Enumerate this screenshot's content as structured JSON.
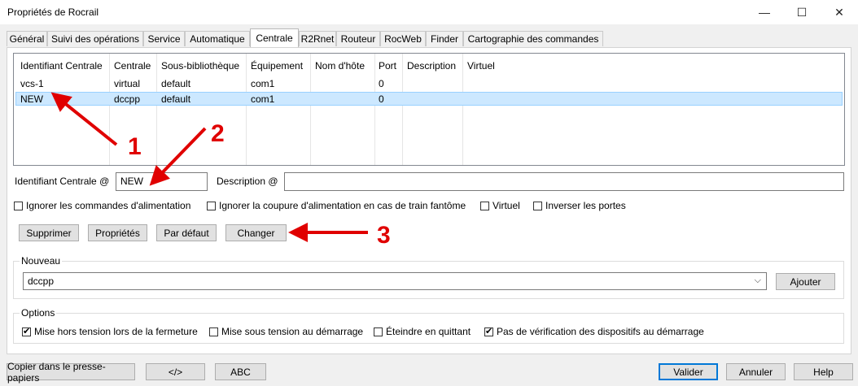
{
  "window": {
    "title": "Propriétés de Rocrail",
    "minimize_icon": "—",
    "maximize_icon": "☐",
    "close_icon": "✕"
  },
  "tabs": [
    {
      "label": "Général"
    },
    {
      "label": "Suivi des opérations"
    },
    {
      "label": "Service"
    },
    {
      "label": "Automatique"
    },
    {
      "label": "Centrale"
    },
    {
      "label": "R2Rnet"
    },
    {
      "label": "Routeur"
    },
    {
      "label": "RocWeb"
    },
    {
      "label": "Finder"
    },
    {
      "label": "Cartographie des commandes"
    }
  ],
  "table": {
    "headers": [
      "Identifiant Centrale",
      "Centrale",
      "Sous-bibliothèque",
      "Équipement",
      "Nom d'hôte",
      "Port",
      "Description",
      "Virtuel"
    ],
    "rows": [
      [
        "vcs-1",
        "virtual",
        "default",
        "com1",
        "",
        "0",
        "",
        ""
      ],
      [
        "NEW",
        "dccpp",
        "default",
        "com1",
        "",
        "0",
        "",
        ""
      ]
    ],
    "selected_row": 1
  },
  "form": {
    "id_label": "Identifiant Centrale @",
    "id_value": "NEW",
    "desc_label": "Description @",
    "desc_value": ""
  },
  "checkboxes": [
    {
      "label": "Ignorer les commandes d'alimentation",
      "checked": false
    },
    {
      "label": "Ignorer la coupure d'alimentation en cas de train fantôme",
      "checked": false
    },
    {
      "label": "Virtuel",
      "checked": false
    },
    {
      "label": "Inverser les portes",
      "checked": false
    }
  ],
  "actions": {
    "delete": "Supprimer",
    "props": "Propriétés",
    "default": "Par défaut",
    "change": "Changer"
  },
  "nouveau": {
    "title": "Nouveau",
    "selected": "dccpp",
    "add": "Ajouter"
  },
  "options": {
    "title": "Options",
    "items": [
      {
        "label": "Mise hors tension lors de la fermeture",
        "checked": true
      },
      {
        "label": "Mise sous tension au démarrage",
        "checked": false
      },
      {
        "label": "Éteindre en quittant",
        "checked": false
      },
      {
        "label": "Pas de vérification des dispositifs au démarrage",
        "checked": true
      }
    ]
  },
  "footer": {
    "copy": "Copier dans le presse-papiers",
    "code": "</>",
    "abc": "ABC",
    "ok": "Valider",
    "cancel": "Annuler",
    "help": "Help"
  },
  "annotations": {
    "n1": "1",
    "n2": "2",
    "n3": "3",
    "color": "#e00000"
  }
}
